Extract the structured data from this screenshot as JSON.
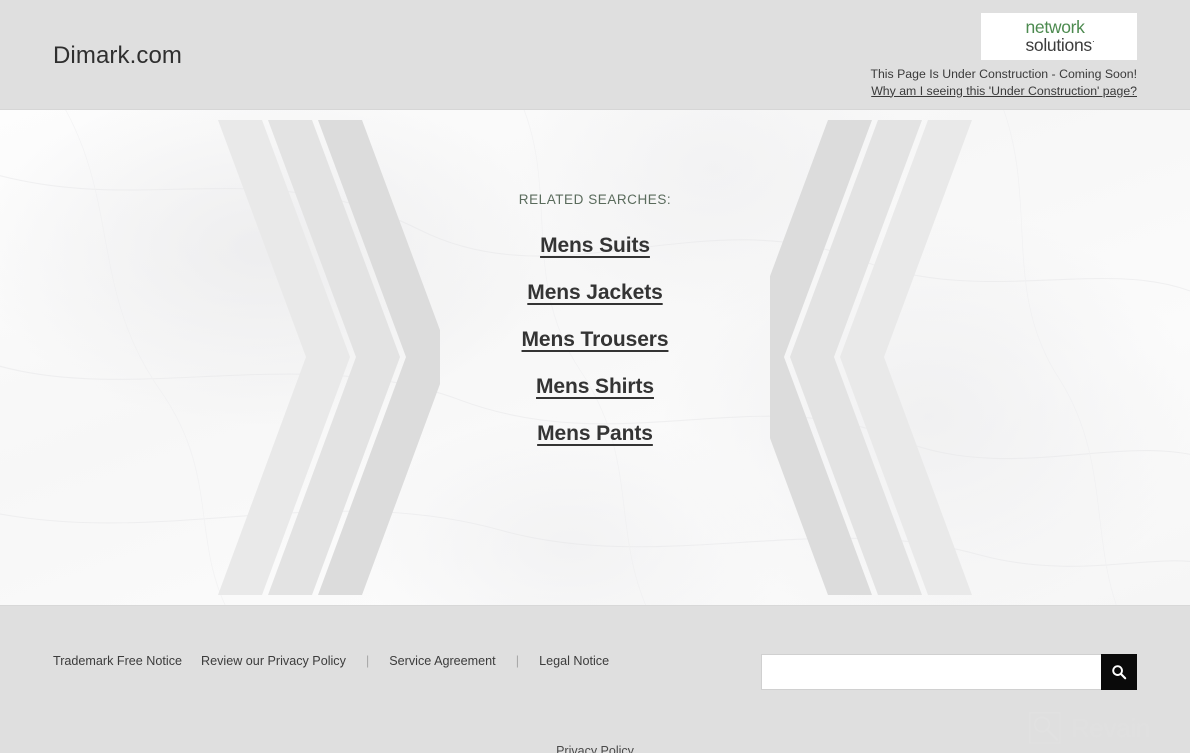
{
  "header": {
    "site_title": "Dimark.com",
    "logo": {
      "name": "network-solutions-logo",
      "line1": "network",
      "line2": "solutions",
      "registered_mark": "·",
      "green": "#4c8a4f",
      "dark": "#3c3c3c"
    },
    "notice_line1": "This Page Is Under Construction - Coming Soon!",
    "notice_link": "Why am I seeing this 'Under Construction' page?"
  },
  "main": {
    "related_label": "RELATED SEARCHES:",
    "related_label_color": "#5a6b5c",
    "links": [
      {
        "label": "Mens Suits"
      },
      {
        "label": "Mens Jackets"
      },
      {
        "label": "Mens Trousers"
      },
      {
        "label": "Mens Shirts"
      },
      {
        "label": "Mens Pants"
      }
    ]
  },
  "footer": {
    "links": [
      {
        "label": "Trademark Free Notice"
      },
      {
        "label": "Review our Privacy Policy"
      },
      {
        "label": "Service Agreement"
      },
      {
        "label": "Legal Notice"
      }
    ],
    "separator": "|",
    "search": {
      "value": "",
      "placeholder": "",
      "button_icon": "search-icon"
    },
    "bottom_text": "Privacy Policy"
  },
  "watermark": {
    "text": "Revain",
    "icon": "magnifier-square-icon",
    "color": "#e2e2e2"
  },
  "colors": {
    "header_bg": "#dfdfdf",
    "footer_bg": "#dfdfdf",
    "hero_bg": "#f8f8f8",
    "link_text": "#343434",
    "search_button_bg": "#0a0a0a"
  }
}
